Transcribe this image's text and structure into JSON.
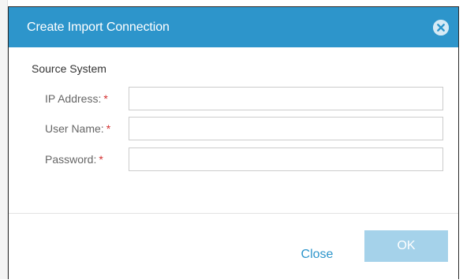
{
  "dialog": {
    "title": "Create Import Connection",
    "close_icon": "close-circle-icon",
    "section_title": "Source System",
    "fields": [
      {
        "label": "IP Address:",
        "required_mark": "*",
        "value": "",
        "placeholder": ""
      },
      {
        "label": "User Name:",
        "required_mark": "*",
        "value": "",
        "placeholder": ""
      },
      {
        "label": "Password:",
        "required_mark": "*",
        "value": "",
        "placeholder": ""
      }
    ],
    "footer": {
      "close_label": "Close",
      "ok_label": "OK",
      "ok_enabled": false
    }
  },
  "colors": {
    "header": "#2d95cb",
    "accent": "#2d95cb",
    "ok_disabled": "#a5d2ea",
    "required": "#d32f2f"
  }
}
